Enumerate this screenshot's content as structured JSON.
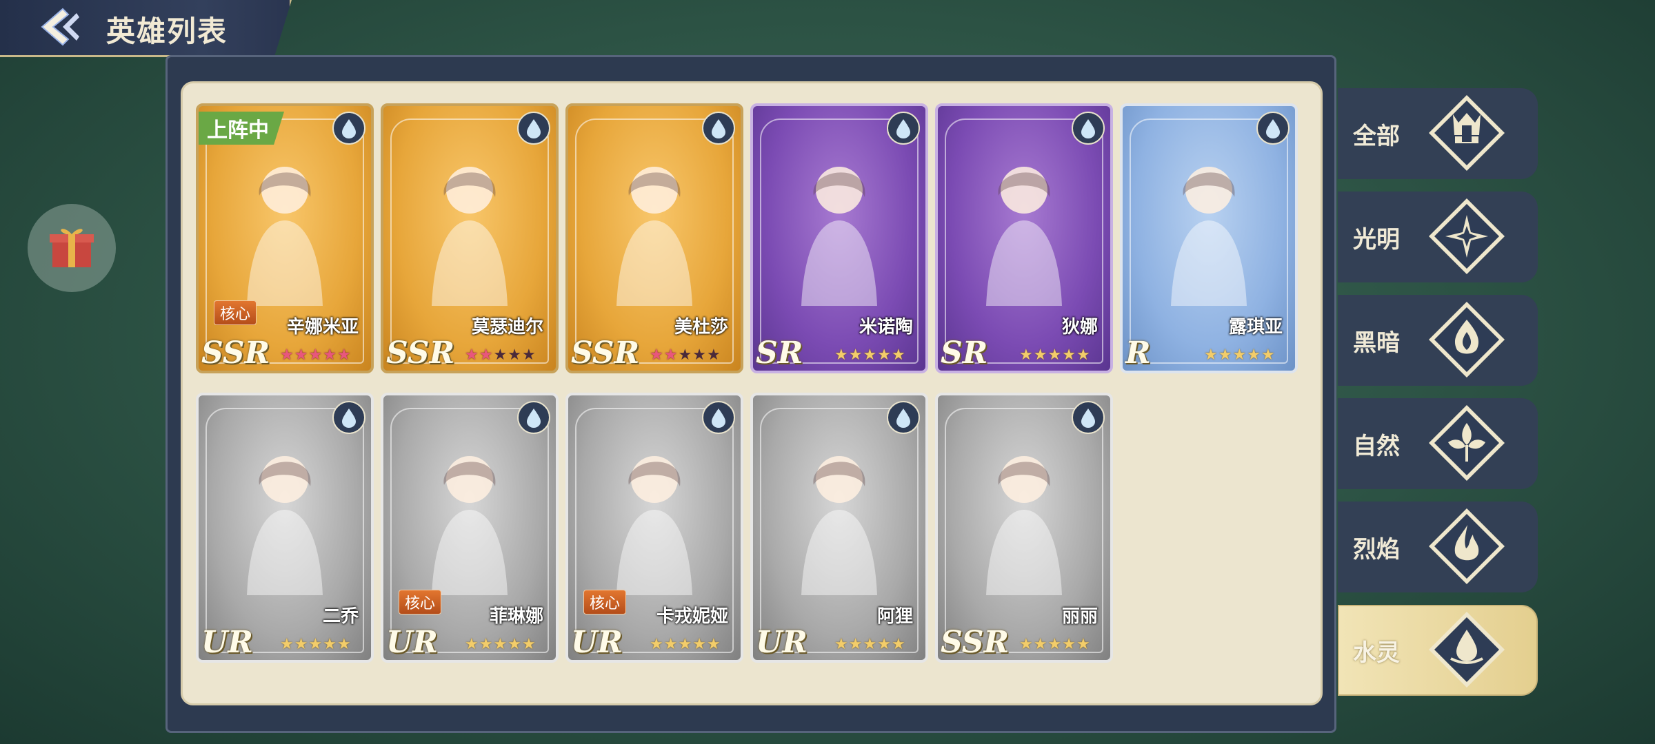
{
  "header": {
    "title": "英雄列表"
  },
  "heroes": [
    {
      "name": "辛娜米亚",
      "rarity": "SSR",
      "frame": "gold",
      "deployed_label": "上阵中",
      "core_label": "核心",
      "stars": [
        "r",
        "r",
        "r",
        "r",
        "r"
      ]
    },
    {
      "name": "莫瑟迪尔",
      "rarity": "SSR",
      "frame": "gold",
      "deployed_label": "",
      "core_label": "",
      "stars": [
        "r",
        "r",
        "d",
        "d",
        "d"
      ]
    },
    {
      "name": "美杜莎",
      "rarity": "SSR",
      "frame": "gold",
      "deployed_label": "",
      "core_label": "",
      "stars": [
        "r",
        "r",
        "d",
        "d",
        "d"
      ]
    },
    {
      "name": "米诺陶",
      "rarity": "SR",
      "frame": "purple",
      "deployed_label": "",
      "core_label": "",
      "stars": [
        "g",
        "g",
        "g",
        "g",
        "g"
      ]
    },
    {
      "name": "狄娜",
      "rarity": "SR",
      "frame": "purple",
      "deployed_label": "",
      "core_label": "",
      "stars": [
        "g",
        "g",
        "g",
        "g",
        "g"
      ]
    },
    {
      "name": "露琪亚",
      "rarity": "R",
      "frame": "blue",
      "deployed_label": "",
      "core_label": "",
      "stars": [
        "g",
        "g",
        "g",
        "g",
        "g"
      ]
    },
    {
      "name": "二乔",
      "rarity": "UR",
      "frame": "grey",
      "deployed_label": "",
      "core_label": "",
      "stars": [
        "g",
        "g",
        "g",
        "g",
        "g"
      ]
    },
    {
      "name": "菲琳娜",
      "rarity": "UR",
      "frame": "grey",
      "deployed_label": "",
      "core_label": "核心",
      "stars": [
        "g",
        "g",
        "g",
        "g",
        "g"
      ]
    },
    {
      "name": "卡戎妮娅",
      "rarity": "UR",
      "frame": "grey",
      "deployed_label": "",
      "core_label": "核心",
      "stars": [
        "g",
        "g",
        "g",
        "g",
        "g"
      ]
    },
    {
      "name": "阿狸",
      "rarity": "UR",
      "frame": "grey",
      "deployed_label": "",
      "core_label": "",
      "stars": [
        "g",
        "g",
        "g",
        "g",
        "g"
      ]
    },
    {
      "name": "丽丽",
      "rarity": "SSR",
      "frame": "grey",
      "deployed_label": "",
      "core_label": "",
      "stars": [
        "g",
        "g",
        "g",
        "g",
        "g"
      ]
    }
  ],
  "filters": [
    {
      "label": "全部",
      "icon": "crown-icon",
      "active": false
    },
    {
      "label": "光明",
      "icon": "light-star-icon",
      "active": false
    },
    {
      "label": "黑暗",
      "icon": "dark-flame-icon",
      "active": false
    },
    {
      "label": "自然",
      "icon": "leaf-icon",
      "active": false
    },
    {
      "label": "烈焰",
      "icon": "fire-icon",
      "active": false
    },
    {
      "label": "水灵",
      "icon": "water-drop-icon",
      "active": true
    }
  ],
  "colors": {
    "accent_gold": "#c9b98a",
    "panel_bg": "#ece5cf",
    "filter_bar": "#334055"
  }
}
